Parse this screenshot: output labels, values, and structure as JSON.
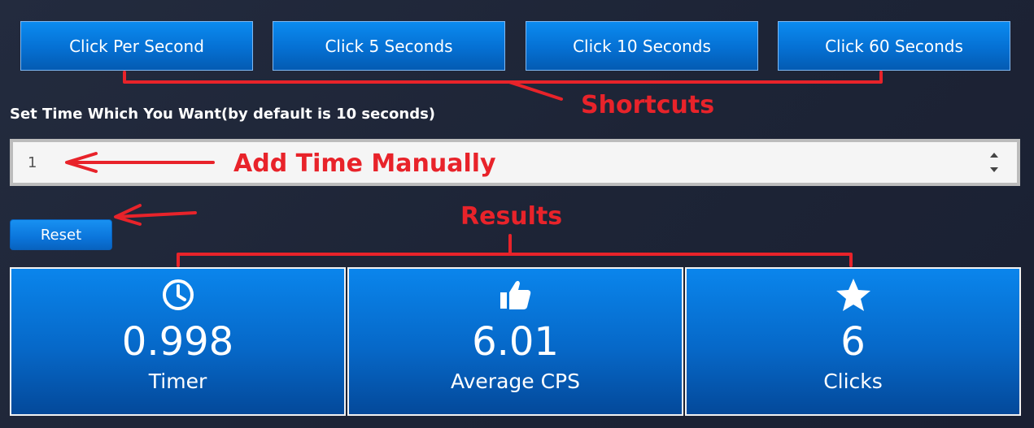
{
  "shortcuts": [
    {
      "label": "Click Per Second"
    },
    {
      "label": "Click 5 Seconds"
    },
    {
      "label": "Click 10 Seconds"
    },
    {
      "label": "Click 60 Seconds"
    }
  ],
  "set_time": {
    "label": "Set Time Which You Want(by default is 10 seconds)",
    "value": "1"
  },
  "reset": {
    "label": "Reset"
  },
  "stats": [
    {
      "icon": "clock-icon",
      "value": "0.998",
      "label": "Timer"
    },
    {
      "icon": "thumbs-up-icon",
      "value": "6.01",
      "label": "Average CPS"
    },
    {
      "icon": "star-icon",
      "value": "6",
      "label": "Clicks"
    }
  ],
  "annotations": {
    "shortcuts": "Shortcuts",
    "add_time": "Add Time Manually",
    "results": "Results"
  },
  "colors": {
    "background": "#1f2638",
    "button_blue": "#0570d3",
    "annotation_red": "#e8232a"
  }
}
